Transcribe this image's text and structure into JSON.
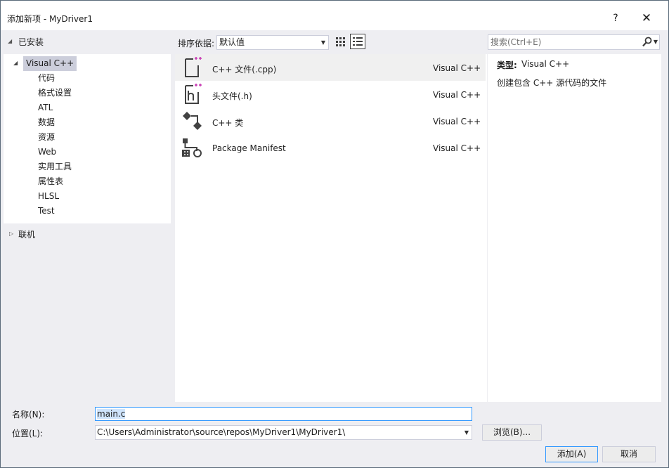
{
  "window": {
    "title": "添加新项 - MyDriver1",
    "help_label": "?",
    "close_label": "✕"
  },
  "left_panel": {
    "installed_label": "已安装",
    "tree_root": "Visual C++",
    "tree_children": [
      "代码",
      "格式设置",
      "ATL",
      "数据",
      "资源",
      "Web",
      "实用工具",
      "属性表",
      "HLSL",
      "Test"
    ],
    "online_label": "联机"
  },
  "toolbar": {
    "sort_label": "排序依据:",
    "sort_value": "默认值",
    "search_placeholder": "搜索(Ctrl+E)"
  },
  "templates": [
    {
      "name": "C++ 文件(.cpp)",
      "language": "Visual C++",
      "icon": "cpp-file-icon",
      "selected": true
    },
    {
      "name": "头文件(.h)",
      "language": "Visual C++",
      "icon": "header-file-icon",
      "selected": false
    },
    {
      "name": "C++ 类",
      "language": "Visual C++",
      "icon": "cpp-class-icon",
      "selected": false
    },
    {
      "name": "Package Manifest",
      "language": "Visual C++",
      "icon": "package-manifest-icon",
      "selected": false
    }
  ],
  "details": {
    "type_label": "类型:",
    "type_value": "Visual C++",
    "description": "创建包含 C++ 源代码的文件"
  },
  "form": {
    "name_label": "名称(N):",
    "name_value": "main.c",
    "location_label": "位置(L):",
    "location_value": "C:\\Users\\Administrator\\source\\repos\\MyDriver1\\MyDriver1\\",
    "browse_label": "浏览(B)...",
    "add_label": "添加(A)",
    "cancel_label": "取消"
  },
  "colors": {
    "selection_tree": "#cccedb",
    "focus_border": "#3399ff",
    "icon_accent": "#c83cb4"
  }
}
